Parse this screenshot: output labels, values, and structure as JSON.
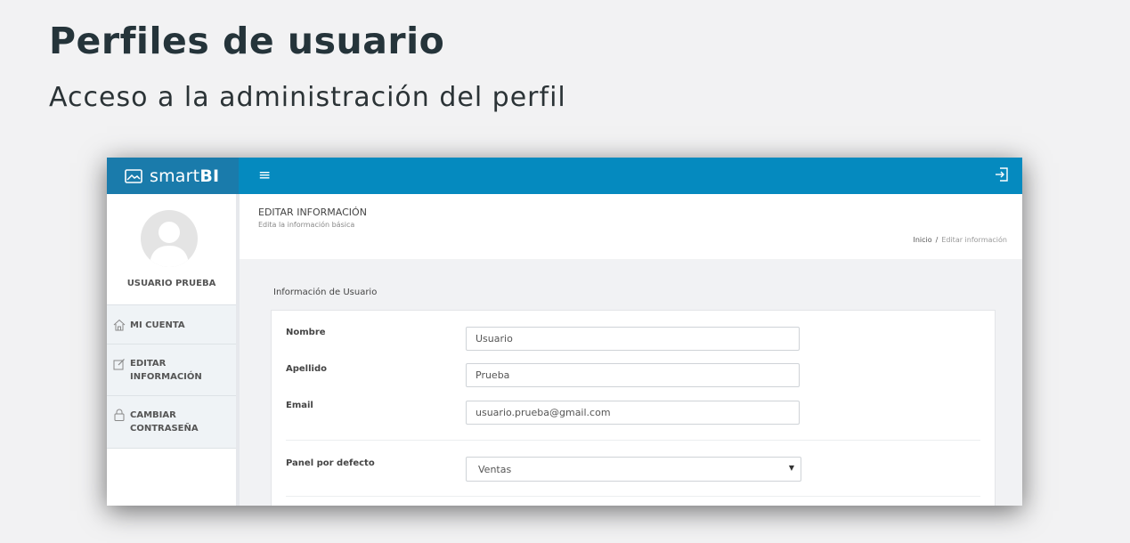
{
  "slide": {
    "title": "Perfiles de usuario",
    "subtitle": "Acceso a la administración del perfil"
  },
  "app": {
    "brand": {
      "light": "smart",
      "bold": "BI"
    },
    "colors": {
      "topbar": "#058abf",
      "brand_bg": "#1a7bab"
    },
    "sidebar": {
      "user_name": "USUARIO PRUEBA",
      "items": [
        {
          "label": "MI CUENTA",
          "icon": "home-icon"
        },
        {
          "label": "EDITAR INFORMACIÓN",
          "icon": "edit-icon"
        },
        {
          "label": "CAMBIAR CONTRASEÑA",
          "icon": "lock-icon"
        }
      ]
    },
    "header": {
      "title": "EDITAR INFORMACIÓN",
      "description": "Edita la información básica",
      "breadcrumb": {
        "home": "Inicio",
        "separator": "/",
        "current": "Editar información"
      }
    },
    "form": {
      "section_title": "Información de Usuario",
      "fields": [
        {
          "label": "Nombre",
          "value": "Usuario"
        },
        {
          "label": "Apellido",
          "value": "Prueba"
        },
        {
          "label": "Email",
          "value": "usuario.prueba@gmail.com"
        }
      ],
      "panel": {
        "label": "Panel por defecto",
        "value": "Ventas"
      }
    }
  }
}
